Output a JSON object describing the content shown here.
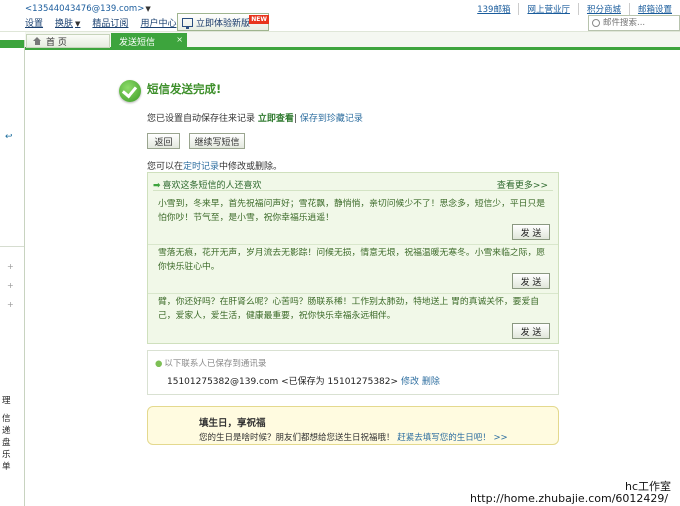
{
  "topbar": {
    "account": "<13544043476@139.com>",
    "menu": [
      {
        "label": "设置",
        "caret": false
      },
      {
        "label": "换肤",
        "caret": true
      },
      {
        "label": "精品订阅",
        "caret": false
      },
      {
        "label": "用户中心",
        "caret": false
      }
    ],
    "try_new_label": "立即体验新版",
    "new_badge": "NEW",
    "toplinks": [
      "139邮箱",
      "网上营业厅",
      "积分商城",
      "邮箱设置"
    ],
    "search_placeholder": "邮件搜索..."
  },
  "tabs": {
    "home_label": "首 页",
    "active_label": "发送短信",
    "close_symbol": "×"
  },
  "sidebar": {
    "partial_lines": [
      "理",
      "信",
      "递",
      "盘",
      "乐",
      "单"
    ]
  },
  "main": {
    "title": "短信发送完成!",
    "autosave_prefix": "您已设置自动保存往来记录 ",
    "view_now": "立即查看",
    "save_to_favorites": "保存到珍藏记录",
    "back_button": "返回",
    "continue_button": "继续写短信",
    "modify_prefix": "您可以在",
    "modify_link": "定时记录",
    "modify_suffix": "中修改或删除。",
    "suggestion": {
      "header": "喜欢这条短信的人还喜欢",
      "more": "查看更多>>",
      "send_label": "发 送",
      "messages": [
        "小雪到，冬来早，首先祝福问声好；雪花飘，静悄悄，亲切问候少不了！思念多，短信少，平日只是怕你吵！节气至，是小雪，祝你幸福乐逍遥！",
        "雪落无痕，花开无声，岁月流去无影踪！问候无损，情意无垠，祝福温暖无寒冬。小雪来临之际，愿你快乐驻心中。",
        "臂，你还好吗？在肝肾么呢？心苦吗？肠联系稀！工作别太肺劲，特地送上 胃的真诚关怀，要爱自己，爱家人，爱生活，健康最重要，祝你快乐幸福永远相伴。"
      ]
    },
    "contact": {
      "note": "以下联系人已保存到通讯录",
      "number": "15101275382@139.com",
      "saved_as": "<已保存为 15101275382>",
      "edit": "修改",
      "delete": "删除"
    },
    "birthday": {
      "title": "填生日，享祝福",
      "text": "您的生日是啥时候？朋友们都想给您送生日祝福哦！",
      "link": "赶紧去填写您的生日吧！",
      "arrows": ">>"
    }
  },
  "watermark": {
    "studio": "hc工作室",
    "url": "http://home.zhubajie.com/6012429/"
  }
}
